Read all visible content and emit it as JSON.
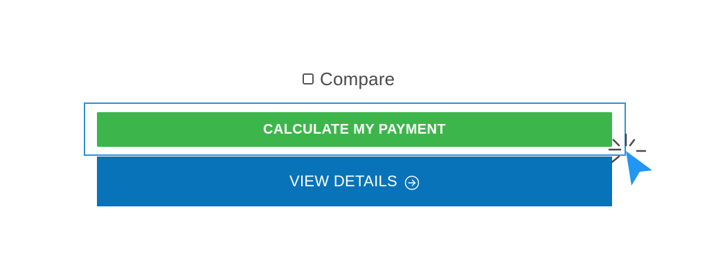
{
  "compare": {
    "label": "Compare",
    "checked": false
  },
  "buttons": {
    "calculate_label": "CALCULATE MY PAYMENT",
    "view_details_label": "VIEW DETAILS"
  },
  "icons": {
    "view_details_icon": "arrow-circle-right-icon",
    "cursor_icon": "click-cursor-icon"
  },
  "colors": {
    "calculate_bg": "#3cb64a",
    "view_details_bg": "#0873b8",
    "focus_ring": "#2f8fd8",
    "cursor": "#2196f3"
  }
}
